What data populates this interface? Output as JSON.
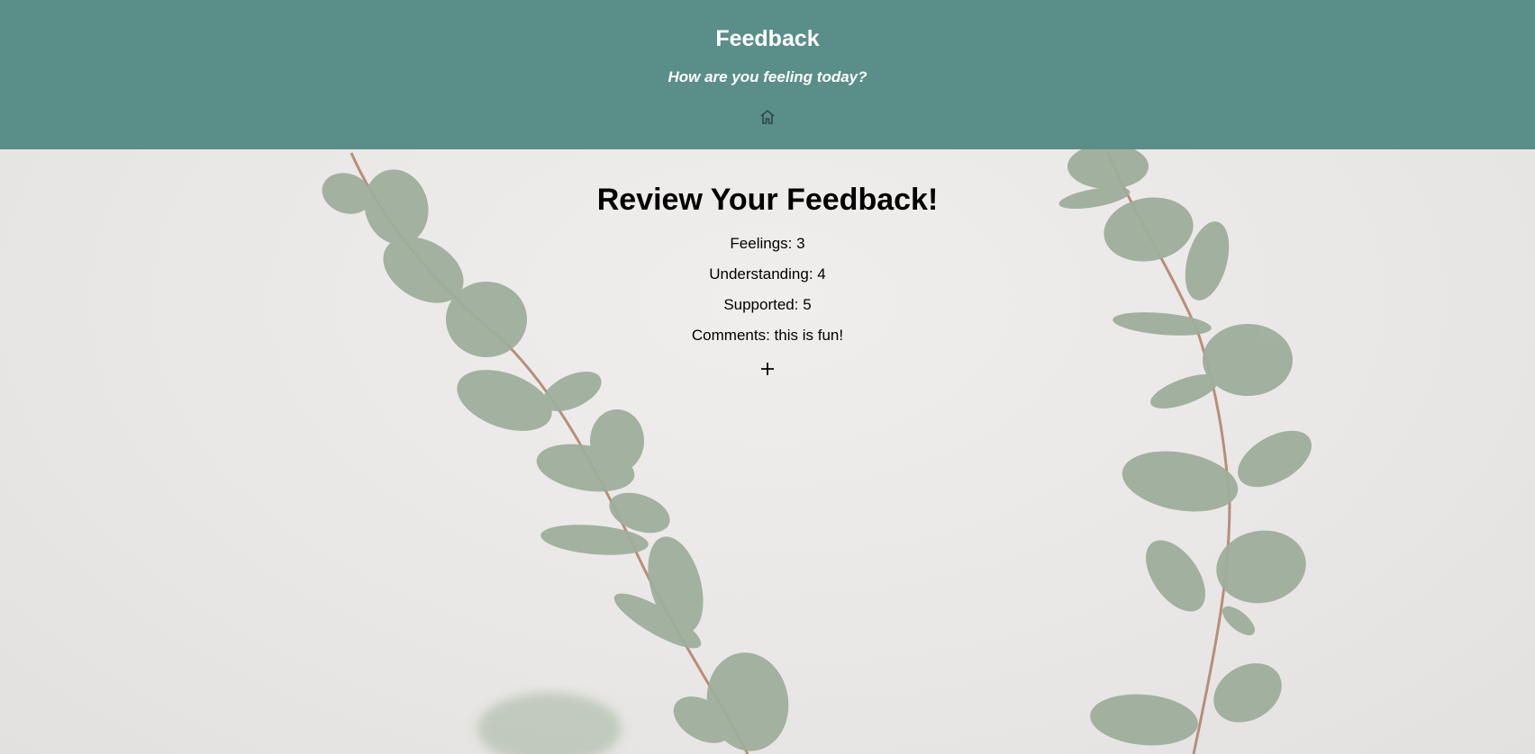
{
  "header": {
    "title": "Feedback",
    "tagline": "How are you feeling today?",
    "home_icon": "home-icon"
  },
  "review": {
    "title": "Review Your Feedback!",
    "feelings": "Feelings: 3",
    "understanding": "Understanding: 4",
    "supported": "Supported: 5",
    "comments": "Comments: this is fun!",
    "add_icon": "plus-icon"
  },
  "colors": {
    "header_bg": "#5a8e89",
    "page_bg": "#ebe9e7",
    "leaf": "#9aaa98"
  }
}
